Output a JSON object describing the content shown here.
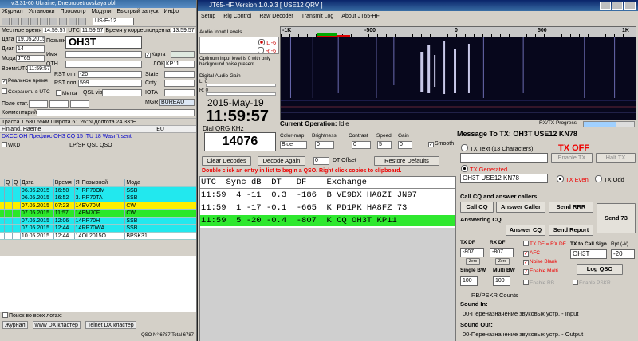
{
  "logger": {
    "title": "v.3.31-60 Ukraine, Dnepropetrovskaya obl.",
    "menu": [
      "Журнал",
      "Установки",
      "Просмотр",
      "Модули",
      "Быстрый запуск",
      "Инфо"
    ],
    "band": "US-E-12",
    "local_time_label": "Местное время",
    "local_time": "14:59:57",
    "utc_label": "UTC",
    "utc_time": "11:59:57",
    "corr_label": "Время у корреспондента",
    "corr_time": "13:59:57",
    "date_label": "Дата",
    "date": "19.05.2015",
    "callsign_label": "Позывной",
    "callsign": "OH3T",
    "band_label": "Диап",
    "band_val": "14",
    "name_label": "Имя",
    "map_label": "Карта",
    "mode_label": "Мода",
    "mode": "JT65",
    "qth_label": "QTH",
    "loc_label": "ЛОК",
    "locator": "KP11",
    "time_label": "Время",
    "time_utc": "UTC",
    "time_val": "11:59:57",
    "rst_sent_label": "RST отп",
    "rst_sent": "-20",
    "rst_rcvd_label": "RST пол",
    "rst_rcvd": "599",
    "state_label": "State",
    "cnty_label": "Cnty",
    "realtime_label": "Реальное время",
    "save_utc_label": "Сохранить в UTC",
    "mark_label": "Метка",
    "qsl_via_label": "QSL via",
    "iota_label": "IOTA",
    "mgr_label": "MGR",
    "mgr_val": "BUREAU",
    "fields_label": "Поле стат.",
    "comment_label": "Комментарий",
    "info1": "Трасса  1 580.65км  Широта 61.26°N  Долгота 24.33°E",
    "info2_country": "Finland, Haeme",
    "info2_cont": "EU",
    "info3": "DXCC  OH  Префикс OH3  CQ 15 ITU 18  Wasn't sent",
    "wkd_label": "WKD",
    "filter_labels": [
      "LP/SP",
      "QSL",
      "QSO"
    ],
    "table_head": [
      "Q",
      "Q",
      "Дата",
      "Время",
      "Я",
      "Позывной",
      "Мода"
    ],
    "rows": [
      {
        "q1": "",
        "q2": "",
        "date": "06.05.2015",
        "time": "16:50",
        "s": "7",
        "call": "RP70OM",
        "mode": "SSB",
        "color": "cyan"
      },
      {
        "q1": "",
        "q2": "",
        "date": "06.05.2015",
        "time": "16:52",
        "s": "3.5",
        "call": "RP70TA",
        "mode": "SSB",
        "color": "cyan"
      },
      {
        "q1": "",
        "q2": "",
        "date": "07.05.2015",
        "time": "07:23",
        "s": "14",
        "call": "EV70M",
        "mode": "CW",
        "color": "yellow"
      },
      {
        "q1": "",
        "q2": "",
        "date": "07.05.2015",
        "time": "11:57",
        "s": "14",
        "call": "EM70F",
        "mode": "CW",
        "color": "green"
      },
      {
        "q1": "",
        "q2": "",
        "date": "07.05.2015",
        "time": "12:06",
        "s": "14",
        "call": "RP70H",
        "mode": "SSB",
        "color": "cyan"
      },
      {
        "q1": "",
        "q2": "",
        "date": "07.05.2015",
        "time": "12:44",
        "s": "14",
        "call": "RP70WA",
        "mode": "SSB",
        "color": "cyan"
      },
      {
        "q1": "",
        "q2": "",
        "date": "10.05.2015",
        "time": "12:44",
        "s": "14",
        "call": "OL2015O",
        "mode": "BPSK31",
        "color": "white"
      }
    ],
    "search_label": "Поиск во всех логах:",
    "bottom_tabs": [
      "Журнал",
      "www DX кластер",
      "Telnet DX кластер"
    ],
    "qso_count": "QSO N° 6787 Total 6787"
  },
  "jt65": {
    "title": "JT65-HF Version 1.0.9.3  [ USE12 QRV ]",
    "menu": [
      "Setup",
      "Rig Control",
      "Raw Decoder",
      "Transmit Log",
      "About JT65-HF"
    ],
    "levels_title": "Audio Input Levels",
    "level_l": "L -6",
    "level_r": "R -6",
    "levels_note": "Optimum input level is 0 with only background noise present.",
    "digital_gain": "Digital Audio Gain",
    "gain_l": "L: 0",
    "gain_r": "R: 0",
    "date": "2015-May-19",
    "clock": "11:59:57",
    "dial_label": "Dial QRG KHz",
    "dial_qrg": "14076",
    "wf_scale": [
      "-1K",
      "-500",
      "0",
      "500",
      "1K"
    ],
    "current_op_label": "Current Operation:",
    "current_op": "Idle",
    "colormap_label": "Color-map",
    "colormap": "Blue",
    "brightness_label": "Brightness",
    "brightness": "0",
    "contrast_label": "Contrast",
    "contrast": "0",
    "speed_label": "Speed",
    "speed": "5",
    "gain_label": "Gain",
    "gain": "0",
    "smooth_label": "Smooth",
    "clear_label": "Clear Decodes",
    "decode_label": "Decode Again",
    "dt_label": "DT Offset",
    "dt_val": "0",
    "restore_label": "Restore Defaults",
    "hint": "Double click an entry in list to begin a QSO.  Right click copies to clipboard.",
    "dec_head": "UTC  Sync dB  DT   DF    Exchange",
    "decodes": [
      {
        "line": "11:59  4 -11  0.3  -186  B VE9DX HA8ZI JN97",
        "hl": false
      },
      {
        "line": "11:59  1 -17 -0.1  -665  K PD1PK HA8FZ 73",
        "hl": false
      },
      {
        "line": "11:59  5 -20 -0.4  -807  K CQ OH3T KP11",
        "hl": true
      }
    ],
    "rxtx_label": "RX/TX Progress",
    "msg_to": "Message To TX: OH3T USE12 KN78",
    "tx_off": "TX OFF",
    "tx_text_label": "TX Text (13 Characters)",
    "enable_tx": "Enable TX",
    "halt_tx": "Halt TX",
    "tx_generated_label": "TX Generated",
    "tx_generated": "OH3T USE12 KN78",
    "tx_even": "TX Even",
    "tx_odd": "TX Odd",
    "cq_label": "Call CQ and answer callers",
    "call_cq": "Call CQ",
    "answer_caller": "Answer Caller",
    "send_rrr": "Send RRR",
    "send73": "Send 73",
    "answering_label": "Answering CQ",
    "answer_cq": "Answer CQ",
    "send_report": "Send Report",
    "txdf_label": "TX DF",
    "txdf": "-807",
    "rxdf_label": "RX DF",
    "rxdf": "-807",
    "txdfrxdf_label": "TX DF = RX DF",
    "afc_label": "AFC",
    "noise_label": "Noise Blank",
    "multi_label": "Enable Multi",
    "rx_label": "Enable RB",
    "psk_label": "Enable PSKR",
    "tx_call_label": "TX to Call Sign",
    "tx_call": "OH3T",
    "rpt_label": "Rpt (-#)",
    "rpt": "-20",
    "zero_label": "Zero",
    "single_bw_label": "Single BW",
    "single_bw": "100",
    "multi_bw_label": "Multi BW",
    "multi_bw": "100",
    "log_qso": "Log QSO",
    "rb_counts": "RB/PSKR Counts",
    "sound_in_label": "Sound In:",
    "sound_in": "00-Переназначение звуковых устр. - Input",
    "sound_out_label": "Sound Out:",
    "sound_out": "00-Переназначение звуковых устр. - Output"
  },
  "colors": {
    "cyan": "#22e8ee",
    "yellow": "#ffef00",
    "green": "#2ae82a",
    "white": "#ffffff",
    "tx_off": "#e00000"
  }
}
